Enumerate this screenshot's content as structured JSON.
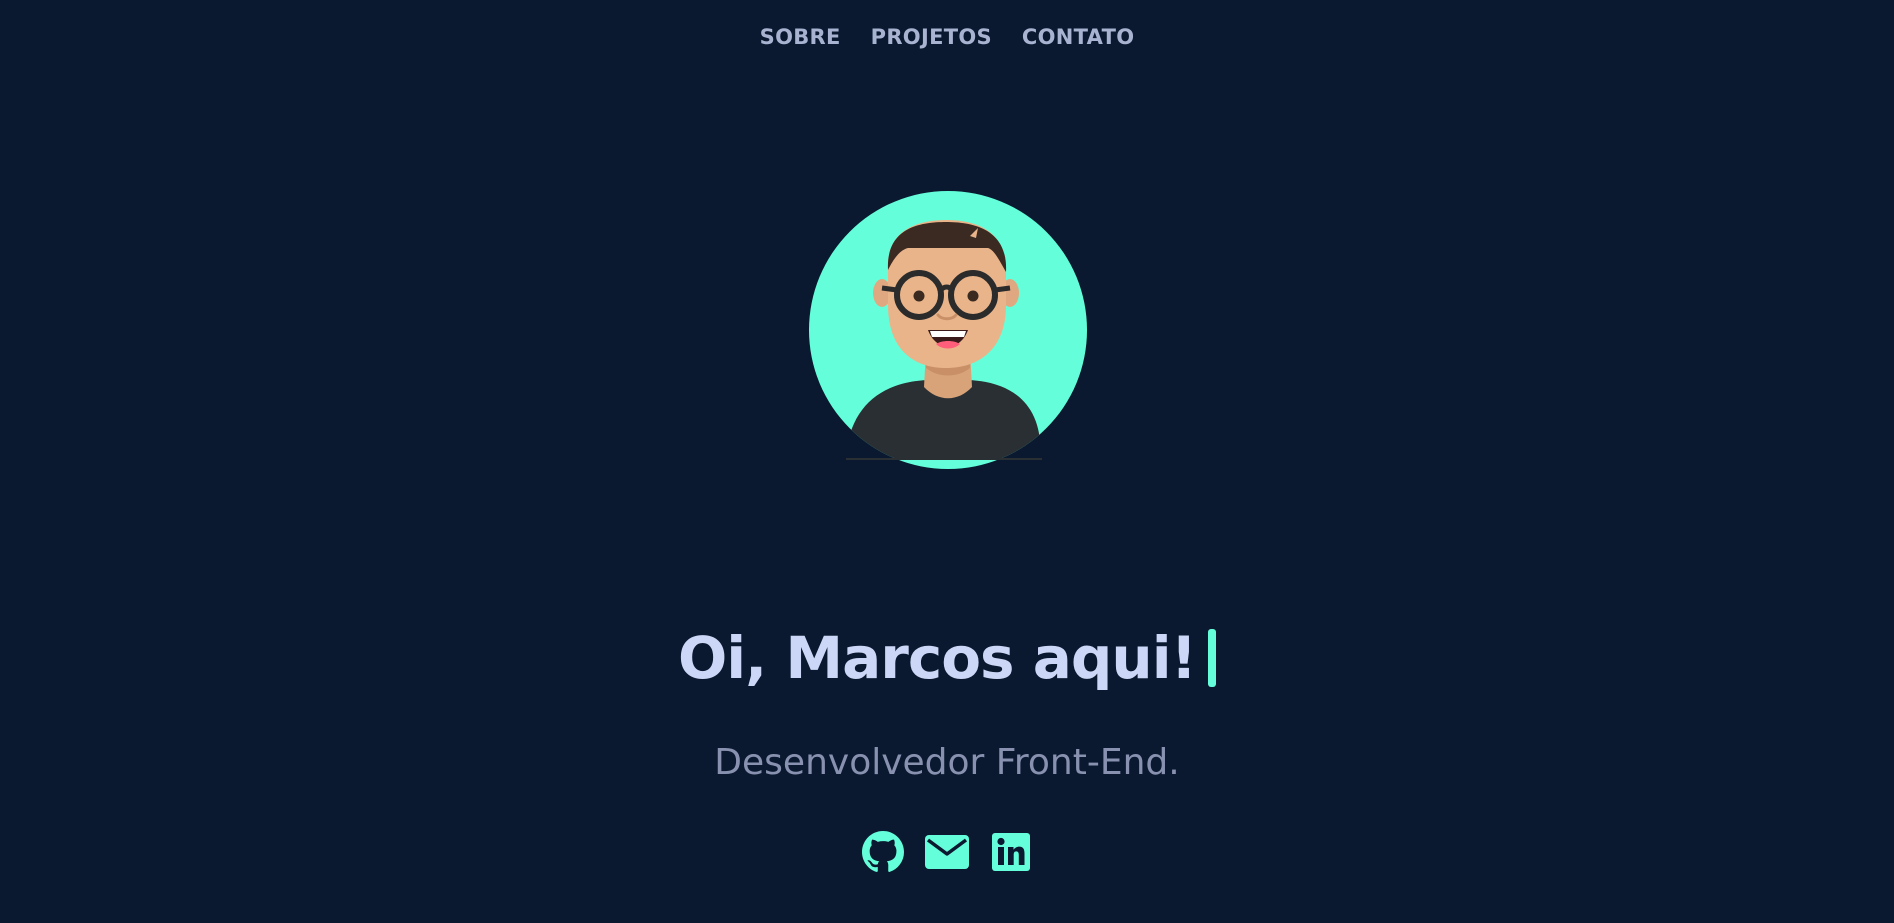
{
  "nav": {
    "items": [
      {
        "label": "SOBRE"
      },
      {
        "label": "PROJETOS"
      },
      {
        "label": "CONTATO"
      }
    ]
  },
  "hero": {
    "greeting": "Oi, Marcos aqui!",
    "role": "Desenvolvedor Front-End."
  },
  "social": {
    "icons": [
      "github-icon",
      "email-icon",
      "linkedin-icon"
    ]
  },
  "colors": {
    "background": "#0a192f",
    "accent": "#64ffda",
    "heading": "#ccd6f6",
    "text": "#8892b0",
    "nav": "#a8b2d1"
  }
}
